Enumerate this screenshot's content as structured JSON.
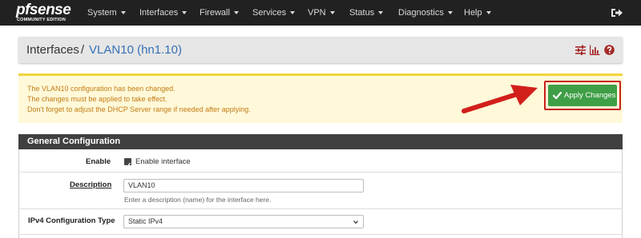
{
  "brand": {
    "logo_text": "pfsense",
    "edition": "COMMUNITY EDITION"
  },
  "nav": {
    "items": [
      {
        "label": "System"
      },
      {
        "label": "Interfaces"
      },
      {
        "label": "Firewall"
      },
      {
        "label": "Services"
      },
      {
        "label": "VPN"
      },
      {
        "label": "Status"
      },
      {
        "label": "Diagnostics"
      },
      {
        "label": "Help"
      }
    ],
    "logout_icon": "sign-out-icon"
  },
  "header": {
    "breadcrumb_root": "Interfaces",
    "separator": "/",
    "current": "VLAN10 (hn1.10)",
    "icons": [
      "sliders-icon",
      "bar-chart-icon",
      "help-icon"
    ]
  },
  "alert": {
    "lines": [
      "The VLAN10 configuration has been changed.",
      "The changes must be applied to take effect.",
      "Don't forget to adjust the DHCP Server range if needed after applying."
    ],
    "apply_label": "Apply Changes",
    "apply_icon": "check-icon"
  },
  "panel": {
    "title": "General Configuration",
    "enable": {
      "label": "Enable",
      "checkbox_label": "Enable interface",
      "checked": true
    },
    "description": {
      "label": "Description",
      "value": "VLAN10",
      "help": "Enter a description (name) for the interface here."
    },
    "ipv4_type": {
      "label": "IPv4 Configuration Type",
      "value": "Static IPv4"
    }
  },
  "colors": {
    "navbar": "#212121",
    "link_blue": "#3771b5",
    "alert_bg": "#fff9d9",
    "alert_text": "#c37b14",
    "apply_green": "#3f9f46",
    "annotation_red": "#c8201a",
    "panel_head": "#404040"
  }
}
